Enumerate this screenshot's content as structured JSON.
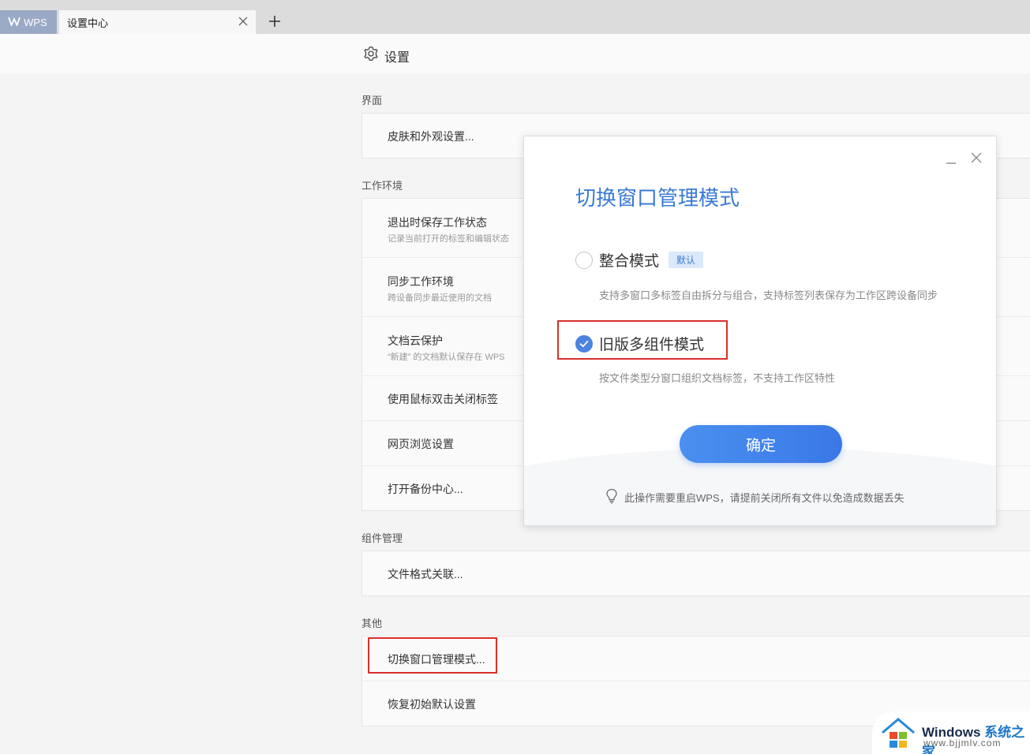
{
  "tabs": {
    "wps_label": "WPS",
    "settings_label": "设置中心"
  },
  "header": {
    "title": "设置"
  },
  "sections": {
    "ui": {
      "label": "界面",
      "items": [
        {
          "label": "皮肤和外观设置..."
        }
      ]
    },
    "work_env": {
      "label": "工作环境",
      "items": [
        {
          "label": "退出时保存工作状态",
          "desc": "记录当前打开的标签和编辑状态"
        },
        {
          "label": "同步工作环境",
          "desc": "跨设备同步最近使用的文档"
        },
        {
          "label": "文档云保护",
          "desc": "“新建” 的文档默认保存在 WPS"
        },
        {
          "label": "使用鼠标双击关闭标签"
        },
        {
          "label": "网页浏览设置"
        },
        {
          "label": "打开备份中心..."
        }
      ]
    },
    "components": {
      "label": "组件管理",
      "items": [
        {
          "label": "文件格式关联..."
        }
      ]
    },
    "other": {
      "label": "其他",
      "items": [
        {
          "label": "切换窗口管理模式..."
        },
        {
          "label": "恢复初始默认设置"
        }
      ]
    }
  },
  "modal": {
    "title": "切换窗口管理模式",
    "option1": {
      "label": "整合模式",
      "badge": "默认",
      "desc": "支持多窗口多标签自由拆分与组合，支持标签列表保存为工作区跨设备同步",
      "selected": false
    },
    "option2": {
      "label": "旧版多组件模式",
      "desc": "按文件类型分窗口组织文档标签，不支持工作区特性",
      "selected": true
    },
    "confirm_label": "确定",
    "tip": "此操作需要重启WPS，请提前关闭所有文件以免造成数据丢失"
  },
  "watermark": {
    "brand": "Windows",
    "brand_cn": "系统之家",
    "url": "www.bjjmlv.com"
  },
  "colors": {
    "accent": "#3a7ad6",
    "highlight": "#d9302c",
    "radio_checked": "#4d82e0"
  }
}
